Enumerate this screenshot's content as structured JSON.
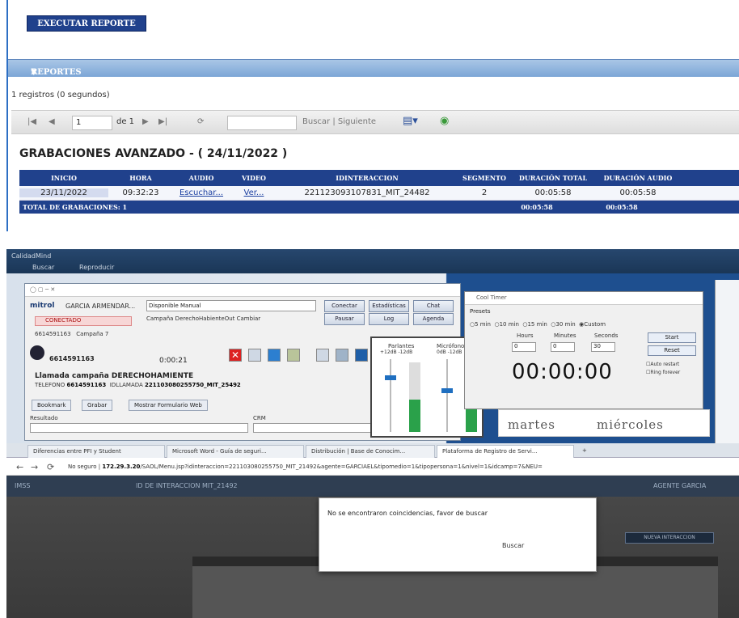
{
  "top": {
    "execute_button": "EXECUTAR REPORTE",
    "reportes_header": "REPORTES",
    "records": "1 registros (0 segundos)",
    "pager": {
      "page": "1",
      "of": "de 1",
      "search_label": "Buscar | Siguiente"
    },
    "table_title": "GRABACIONES AVANZADO - ( 24/11/2022 )",
    "columns": [
      "INICIO",
      "HORA",
      "AUDIO",
      "VIDEO",
      "IDINTERACCION",
      "SEGMENTO",
      "DURACIÓN TOTAL",
      "DURACIÓN AUDIO"
    ],
    "row": {
      "inicio": "23/11/2022",
      "hora": "09:32:23",
      "audio": "Escuchar...",
      "video": "Ver...",
      "id": "221123093107831_MIT_24482",
      "segmento": "2",
      "dur_total": "00:05:58",
      "dur_audio": "00:05:58"
    },
    "total_label": "TOTAL DE GRABACIONES: 1",
    "total_dur": "00:05:58",
    "total_audio": "00:05:58"
  },
  "shot": {
    "app_title": "CalidadMind",
    "menu": [
      "Buscar",
      "Reproducir"
    ],
    "main": {
      "user": "GARCIA ARMENDAR...",
      "status_field": "Disponible Manual",
      "conectado": "CONECTADO",
      "campaign_label": "Campaña",
      "campaign_value": "Campaña 7",
      "phone": "6614591163",
      "timer": "0:00:21",
      "llamada": "Llamada campaña DERECHOHAMIENTE",
      "telefono_label": "TELEFONO",
      "telefono_value": "6614591163",
      "id_label": "IDLLAMADA",
      "id_value": "221103080255750_MIT_25492",
      "buttons": [
        "Conectar",
        "Pausar",
        "Estadísticas",
        "Log",
        "Chat",
        "Agenda"
      ],
      "campaign_line": "Campaña  DerechoHabienteOut  Cambiar",
      "pills": [
        "Bookmark",
        "Grabar",
        "Mostrar Formulario Web"
      ],
      "fields": [
        "Resultado",
        "CRM"
      ]
    },
    "audio": {
      "parlantes": "Parlantes",
      "microfono": "Micrófono",
      "db_p": "+12dB  -12dB",
      "db_m": "0dB   -12dB"
    },
    "timer": {
      "title": "Cool Timer",
      "presets_label": "Presets",
      "presets": [
        "5 min",
        "10 min",
        "15 min",
        "30 min",
        "Custom"
      ],
      "labels": [
        "Hours",
        "Minutes",
        "Seconds"
      ],
      "values": [
        "0",
        "0",
        "30"
      ],
      "big": "00:00:00",
      "start": "Start",
      "reset": "Reset",
      "checks": [
        "Auto restart",
        "Ring forever"
      ]
    },
    "days": [
      "martes",
      "miércoles"
    ],
    "tabs": [
      "Diferencias entre PFI y Student",
      "Microsoft Word - Guía de seguri...",
      "Distribución | Base de Conocim...",
      "Plataforma de Registro de Servi..."
    ],
    "url_prefix": "No seguro |",
    "url_host": "172.29.3.20",
    "url_rest": "/SAOL/Menu.jsp?idinteraccion=221103080255750_MIT_21492&agente=GARCIAEL&tipomedio=1&tipopersona=1&nivel=1&idcamp=7&NEU=",
    "header_left": "IMSS",
    "header_mid": "ID DE INTERACCION MIT_21492",
    "header_right": "AGENTE GARCIA",
    "nuevo_btn": "NUEVA INTERACCION",
    "dialog_msg": "No se encontraron coincidencias, favor de buscar",
    "dialog_btn": "Buscar"
  }
}
